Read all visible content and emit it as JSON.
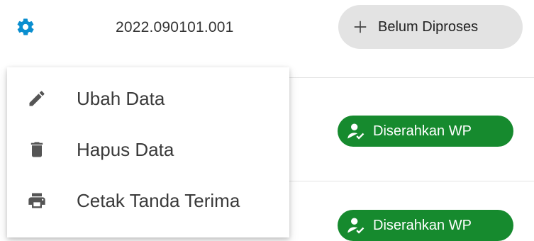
{
  "record": {
    "registration_number": "2022.090101.001"
  },
  "status": {
    "label": "Belum Diproses"
  },
  "rows": [
    {
      "badge_label": "Diserahkan WP"
    },
    {
      "badge_label": "Diserahkan WP"
    }
  ],
  "menu": {
    "items": [
      {
        "label": "Ubah Data",
        "icon": "pencil-icon"
      },
      {
        "label": "Hapus Data",
        "icon": "trash-icon"
      },
      {
        "label": "Cetak Tanda Terima",
        "icon": "printer-icon"
      }
    ]
  },
  "colors": {
    "accent": "#0a8ecf",
    "success": "#168a2e",
    "chip_grey": "#e3e3e3"
  }
}
